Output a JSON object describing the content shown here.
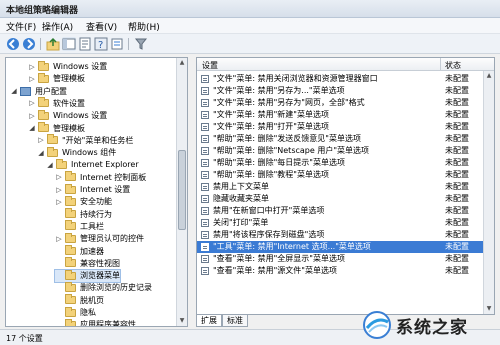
{
  "window": {
    "title": "本地组策略编辑器"
  },
  "menu": [
    "文件(F)",
    "操作(A)",
    "查看(V)",
    "帮助(H)"
  ],
  "left_tree": [
    {
      "label": "Windows 设置",
      "indent": 2,
      "icon": "folder",
      "expander": "▷"
    },
    {
      "label": "管理模板",
      "indent": 2,
      "icon": "folder",
      "expander": "▷"
    },
    {
      "label": "用户配置",
      "indent": 0,
      "icon": "computer",
      "expander": "◢"
    },
    {
      "label": "软件设置",
      "indent": 2,
      "icon": "folder",
      "expander": "▷"
    },
    {
      "label": "Windows 设置",
      "indent": 2,
      "icon": "folder",
      "expander": "▷"
    },
    {
      "label": "管理模板",
      "indent": 2,
      "icon": "folder",
      "expander": "◢"
    },
    {
      "label": "\"开始\"菜单和任务栏",
      "indent": 3,
      "icon": "folder",
      "expander": "▷"
    },
    {
      "label": "Windows 组件",
      "indent": 3,
      "icon": "folder",
      "expander": "◢"
    },
    {
      "label": "Internet Explorer",
      "indent": 4,
      "icon": "folder",
      "expander": "◢"
    },
    {
      "label": "Internet 控制面板",
      "indent": 5,
      "icon": "folder",
      "expander": "▷"
    },
    {
      "label": "Internet 设置",
      "indent": 5,
      "icon": "folder",
      "expander": "▷"
    },
    {
      "label": "安全功能",
      "indent": 5,
      "icon": "folder",
      "expander": "▷"
    },
    {
      "label": "持续行为",
      "indent": 5,
      "icon": "folder",
      "expander": ""
    },
    {
      "label": "工具栏",
      "indent": 5,
      "icon": "folder",
      "expander": ""
    },
    {
      "label": "管理员认可的控件",
      "indent": 5,
      "icon": "folder",
      "expander": "▷"
    },
    {
      "label": "加速器",
      "indent": 5,
      "icon": "folder",
      "expander": ""
    },
    {
      "label": "兼容性视图",
      "indent": 5,
      "icon": "folder",
      "expander": ""
    },
    {
      "label": "浏览器菜单",
      "indent": 5,
      "icon": "folder",
      "expander": "",
      "selected": true
    },
    {
      "label": "删除浏览的历史记录",
      "indent": 5,
      "icon": "folder",
      "expander": ""
    },
    {
      "label": "脱机页",
      "indent": 5,
      "icon": "folder",
      "expander": ""
    },
    {
      "label": "隐私",
      "indent": 5,
      "icon": "folder",
      "expander": ""
    },
    {
      "label": "应用程序兼容性",
      "indent": 5,
      "icon": "folder",
      "expander": ""
    }
  ],
  "settings_header": {
    "col_setting": "设置",
    "col_state": "状态"
  },
  "settings": [
    {
      "text": "\"文件\"菜单: 禁用关闭浏览器和资源管理器窗口",
      "state": "未配置"
    },
    {
      "text": "\"文件\"菜单: 禁用\"另存为...\"菜单选项",
      "state": "未配置"
    },
    {
      "text": "\"文件\"菜单: 禁用\"另存为\"网页，全部\"格式",
      "state": "未配置"
    },
    {
      "text": "\"文件\"菜单: 禁用\"新建\"菜单选项",
      "state": "未配置"
    },
    {
      "text": "\"文件\"菜单: 禁用\"打开\"菜单选项",
      "state": "未配置"
    },
    {
      "text": "\"帮助\"菜单: 删除\"发送反馈意见\"菜单选项",
      "state": "未配置"
    },
    {
      "text": "\"帮助\"菜单: 删除\"Netscape 用户\"菜单选项",
      "state": "未配置"
    },
    {
      "text": "\"帮助\"菜单: 删除\"每日提示\"菜单选项",
      "state": "未配置"
    },
    {
      "text": "\"帮助\"菜单: 删除\"教程\"菜单选项",
      "state": "未配置"
    },
    {
      "text": "禁用上下文菜单",
      "state": "未配置"
    },
    {
      "text": "隐藏收藏夹菜单",
      "state": "未配置"
    },
    {
      "text": "禁用\"在新窗口中打开\"菜单选项",
      "state": "未配置"
    },
    {
      "text": "关闭\"打印\"菜单",
      "state": "未配置"
    },
    {
      "text": "禁用\"将该程序保存到磁盘\"选项",
      "state": "未配置"
    },
    {
      "text": "\"工具\"菜单: 禁用\"Internet 选项...\"菜单选项",
      "state": "未配置",
      "selected": true
    },
    {
      "text": "\"查看\"菜单: 禁用\"全屏显示\"菜单选项",
      "state": "未配置"
    },
    {
      "text": "\"查看\"菜单: 禁用\"源文件\"菜单选项",
      "state": "未配置"
    }
  ],
  "tabs": [
    "扩展",
    "标准"
  ],
  "status": {
    "text": "17 个设置"
  },
  "watermark": {
    "text": "系统之家"
  },
  "colors": {
    "selection": "#3b7bd4",
    "folder": "#f3d27a"
  }
}
